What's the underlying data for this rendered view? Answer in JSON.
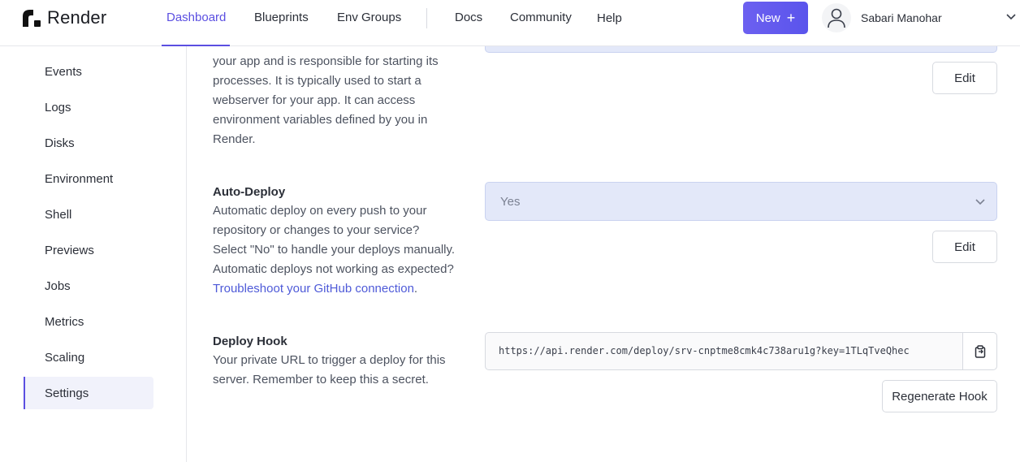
{
  "brand": {
    "name": "Render"
  },
  "nav": {
    "dashboard": "Dashboard",
    "blueprints": "Blueprints",
    "env_groups": "Env Groups",
    "docs": "Docs",
    "community": "Community",
    "help": "Help",
    "new_label": "New",
    "new_icon": "plus-icon"
  },
  "user": {
    "name": "Sabari Manohar",
    "icon": "user-icon"
  },
  "sidebar": {
    "items": [
      "Events",
      "Logs",
      "Disks",
      "Environment",
      "Shell",
      "Previews",
      "Jobs",
      "Metrics",
      "Scaling",
      "Settings"
    ],
    "active": "Settings"
  },
  "start_command": {
    "desc_lines": [
      "your app and is responsible for starting its",
      "processes. It is typically used to start a",
      "webserver for your app. It can access",
      "environment variables defined by you in",
      "Render."
    ],
    "edit_label": "Edit"
  },
  "auto_deploy": {
    "title": "Auto-Deploy",
    "desc_lines": [
      "Automatic deploy on every push to your",
      "repository or changes to your service?",
      "Select \"No\" to handle your deploys manually.",
      "Automatic deploys not working as expected?"
    ],
    "link_text": "Troubleshoot your GitHub connection",
    "link_suffix": ".",
    "value": "Yes",
    "edit_label": "Edit"
  },
  "deploy_hook": {
    "title": "Deploy Hook",
    "desc_lines": [
      "Your private URL to trigger a deploy for this",
      "server. Remember to keep this a secret."
    ],
    "url": "https://api.render.com/deploy/srv-cnptme8cmk4c738aru1g?key=1TLqTveQhec",
    "copy_icon": "clipboard-icon",
    "regenerate_label": "Regenerate Hook"
  },
  "colors": {
    "accent": "#5b4fe1",
    "select_bg": "#e3e8f9",
    "link": "#4e5ad8"
  }
}
